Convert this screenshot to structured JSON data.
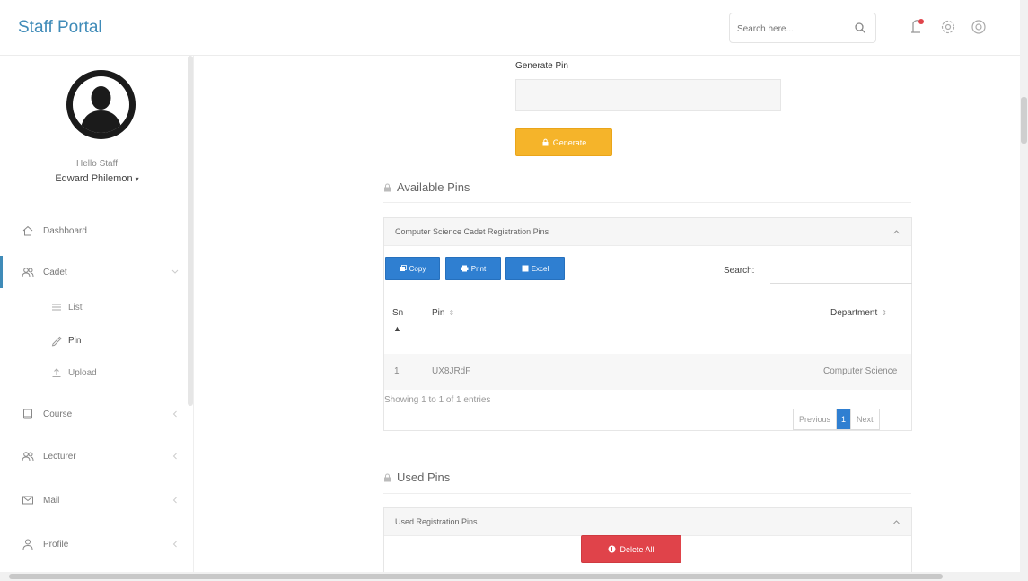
{
  "header": {
    "brand": "Staff Portal",
    "search_placeholder": "Search here..."
  },
  "sidebar": {
    "greeting": "Hello Staff",
    "user_name": "Edward Philemon",
    "items": [
      {
        "label": "Dashboard",
        "icon": "home-icon"
      },
      {
        "label": "Cadet",
        "icon": "users-icon"
      },
      {
        "label": "Course",
        "icon": "book-icon"
      },
      {
        "label": "Lecturer",
        "icon": "users-icon"
      },
      {
        "label": "Mail",
        "icon": "mail-icon"
      },
      {
        "label": "Profile",
        "icon": "user-icon"
      }
    ],
    "cadet_sub": [
      {
        "label": "List",
        "icon": "list-icon"
      },
      {
        "label": "Pin",
        "icon": "pencil-icon"
      },
      {
        "label": "Upload",
        "icon": "upload-icon"
      }
    ]
  },
  "generate": {
    "label": "Generate Pin",
    "button": "Generate"
  },
  "available": {
    "section_title": "Available Pins",
    "panel_title": "Computer Science Cadet Registration Pins",
    "buttons": {
      "copy": "Copy",
      "print": "Print",
      "excel": "Excel"
    },
    "search_label": "Search:",
    "columns": {
      "sn": "Sn",
      "pin": "Pin",
      "department": "Department"
    },
    "rows": [
      {
        "sn": "1",
        "pin": "UX8JRdF",
        "department": "Computer Science"
      }
    ],
    "info": "Showing 1 to 1 of 1 entries",
    "pager": {
      "previous": "Previous",
      "current": "1",
      "next": "Next"
    }
  },
  "used": {
    "section_title": "Used Pins",
    "panel_title": "Used Registration Pins",
    "delete_button": "Delete All"
  },
  "colors": {
    "brand": "#3f8bb8",
    "primary": "#2f7fd1",
    "warning": "#f5b42a",
    "danger": "#e0434a"
  }
}
